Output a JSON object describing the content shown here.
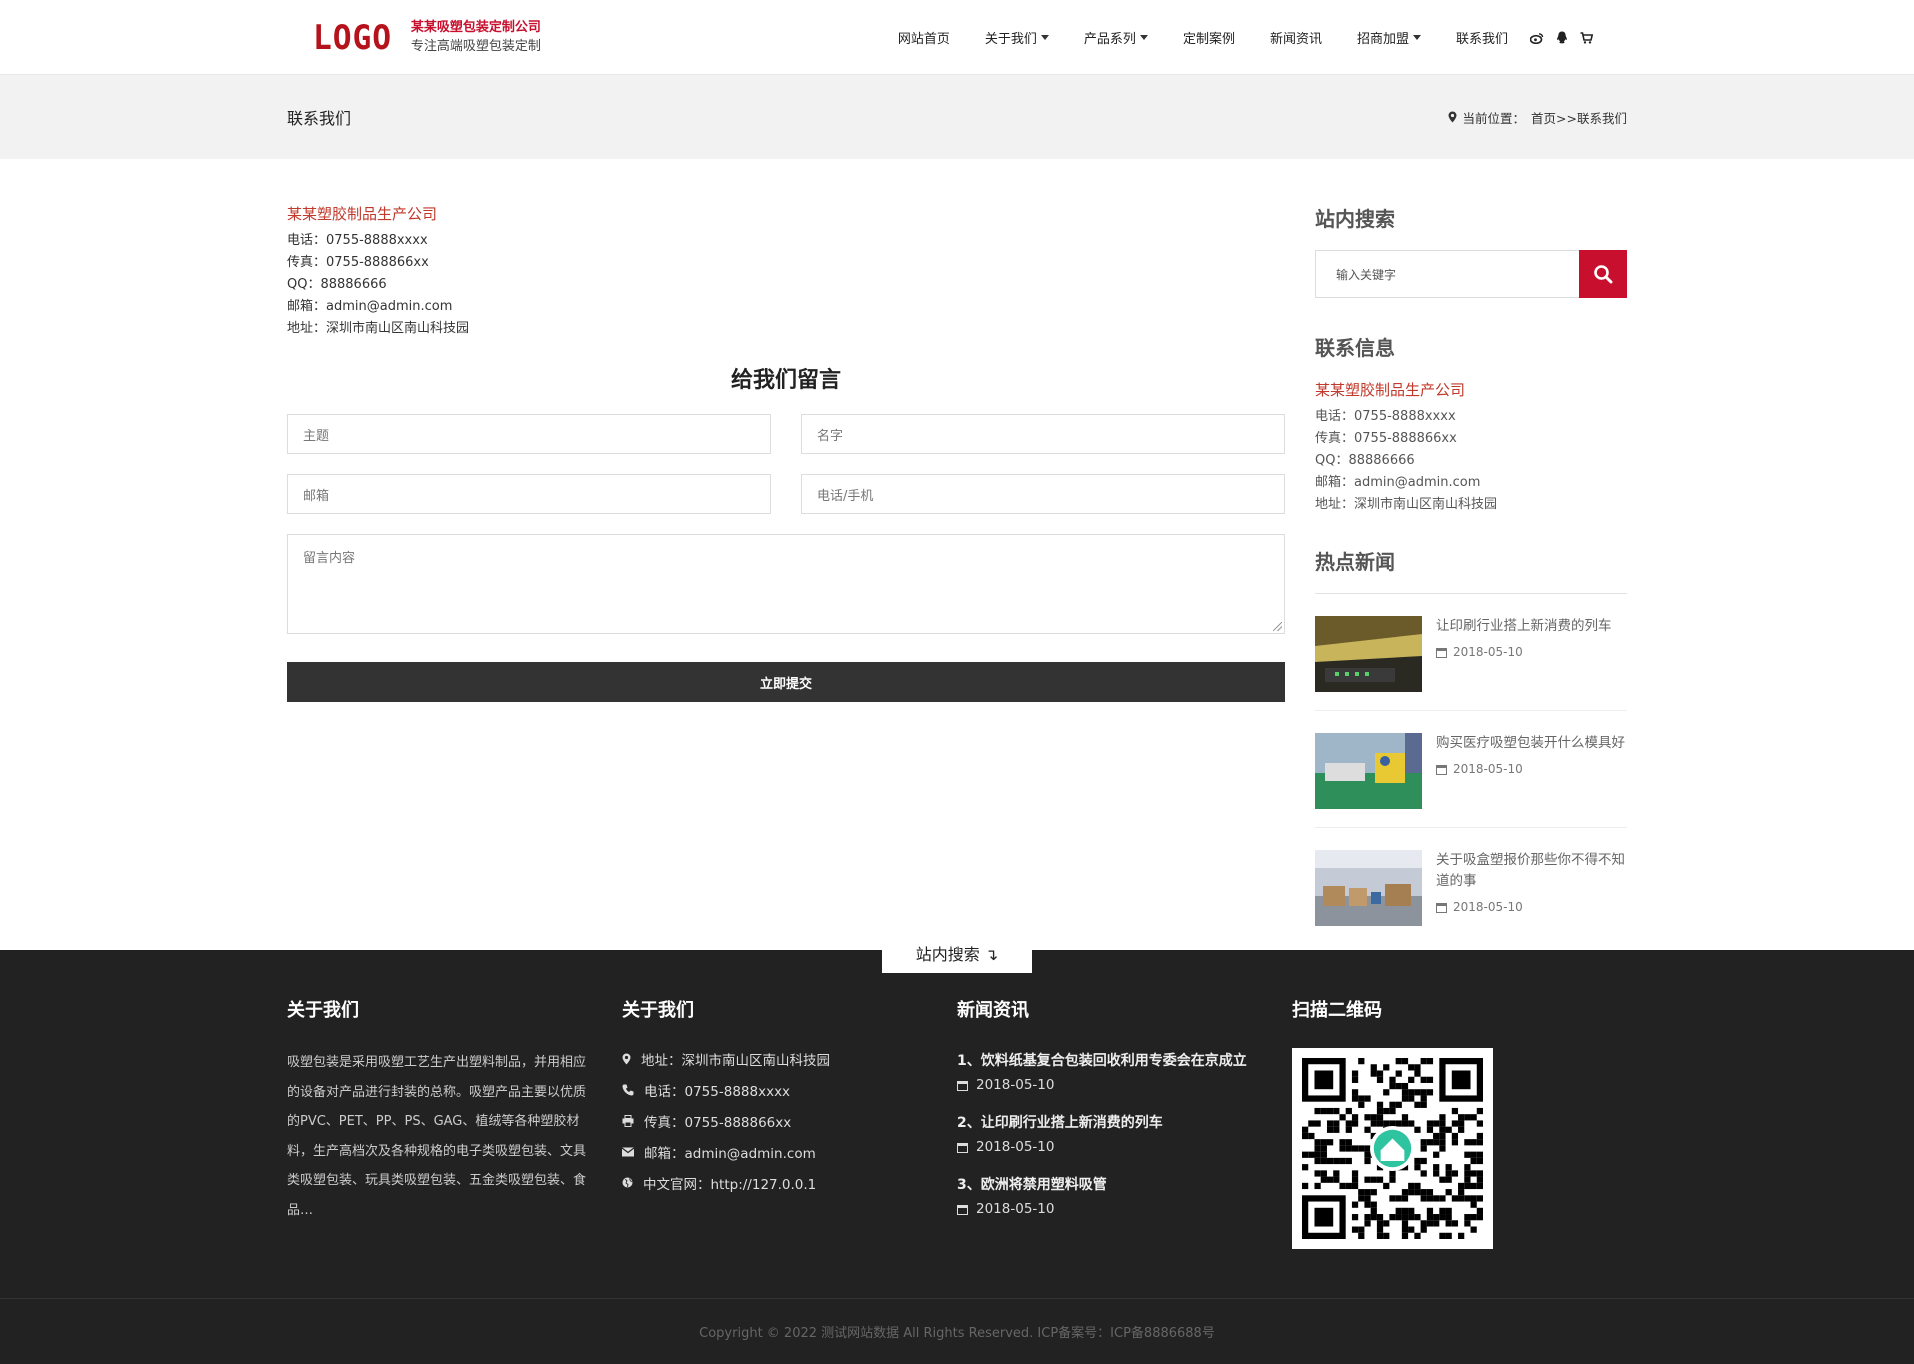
{
  "header": {
    "logo_text": "LOGO",
    "company": "某某吸塑包装定制公司",
    "slogan": "专注高端吸塑包装定制",
    "nav": [
      "网站首页",
      "关于我们",
      "产品系列",
      "定制案例",
      "新闻资讯",
      "招商加盟",
      "联系我们"
    ],
    "icons": [
      "weibo-icon",
      "qq-icon",
      "cart-icon"
    ]
  },
  "banner": {
    "title": "联系我们",
    "location_label": "当前位置：",
    "path": "首页>>联系我们"
  },
  "contact": {
    "company": "某某塑胶制品生产公司",
    "phone": "电话：0755-8888xxxx",
    "fax": "传真：0755-888866xx",
    "qq": "QQ：88886666",
    "email": "邮箱：admin@admin.com",
    "address": "地址：深圳市南山区南山科技园"
  },
  "form": {
    "title": "给我们留言",
    "subject": "主题",
    "name": "名字",
    "email": "邮箱",
    "phone": "电话/手机",
    "message": "留言内容",
    "submit": "立即提交"
  },
  "sidebar": {
    "search_title": "站内搜索",
    "search_placeholder": "输入关键字",
    "contact_title": "联系信息",
    "company": "某某塑胶制品生产公司",
    "phone": "电话：0755-8888xxxx",
    "fax": "传真：0755-888866xx",
    "qq": "QQ：88886666",
    "email": "邮箱：admin@admin.com",
    "address": "地址：深圳市南山区南山科技园",
    "hot_title": "热点新闻",
    "news": [
      {
        "title": "让印刷行业搭上新消费的列车",
        "date": "2018-05-10"
      },
      {
        "title": "购买医疗吸塑包装开什么模具好",
        "date": "2018-05-10"
      },
      {
        "title": "关于吸盒塑报价那些你不得不知道的事",
        "date": "2018-05-10"
      }
    ]
  },
  "footer": {
    "tab": "站内搜索 ↴",
    "about_title": "关于我们",
    "about_text": "吸塑包装是采用吸塑工艺生产出塑料制品，并用相应的设备对产品进行封装的总称。吸塑产品主要以优质的PVC、PET、PP、PS、GAG、植绒等各种塑胶材料，生产高档次及各种规格的电子类吸塑包装、文具类吸塑包装、玩具类吸塑包装、五金类吸塑包装、食品…",
    "contact_title": "关于我们",
    "address": "地址：深圳市南山区南山科技园",
    "phone": "电话：0755-8888xxxx",
    "fax": "传真：0755-888866xx",
    "email": "邮箱：admin@admin.com",
    "site": "中文官网：http://127.0.0.1",
    "news_title": "新闻资讯",
    "news": [
      {
        "title": "1、饮料纸基复合包装回收利用专委会在京成立",
        "date": "2018-05-10"
      },
      {
        "title": "2、让印刷行业搭上新消费的列车",
        "date": "2018-05-10"
      },
      {
        "title": "3、欧洲将禁用塑料吸管",
        "date": "2018-05-10"
      }
    ],
    "qr_title": "扫描二维码",
    "copyright": "Copyright © 2022 测试网站数据 All Rights Reserved.   ICP备案号：ICP备8886688号"
  }
}
